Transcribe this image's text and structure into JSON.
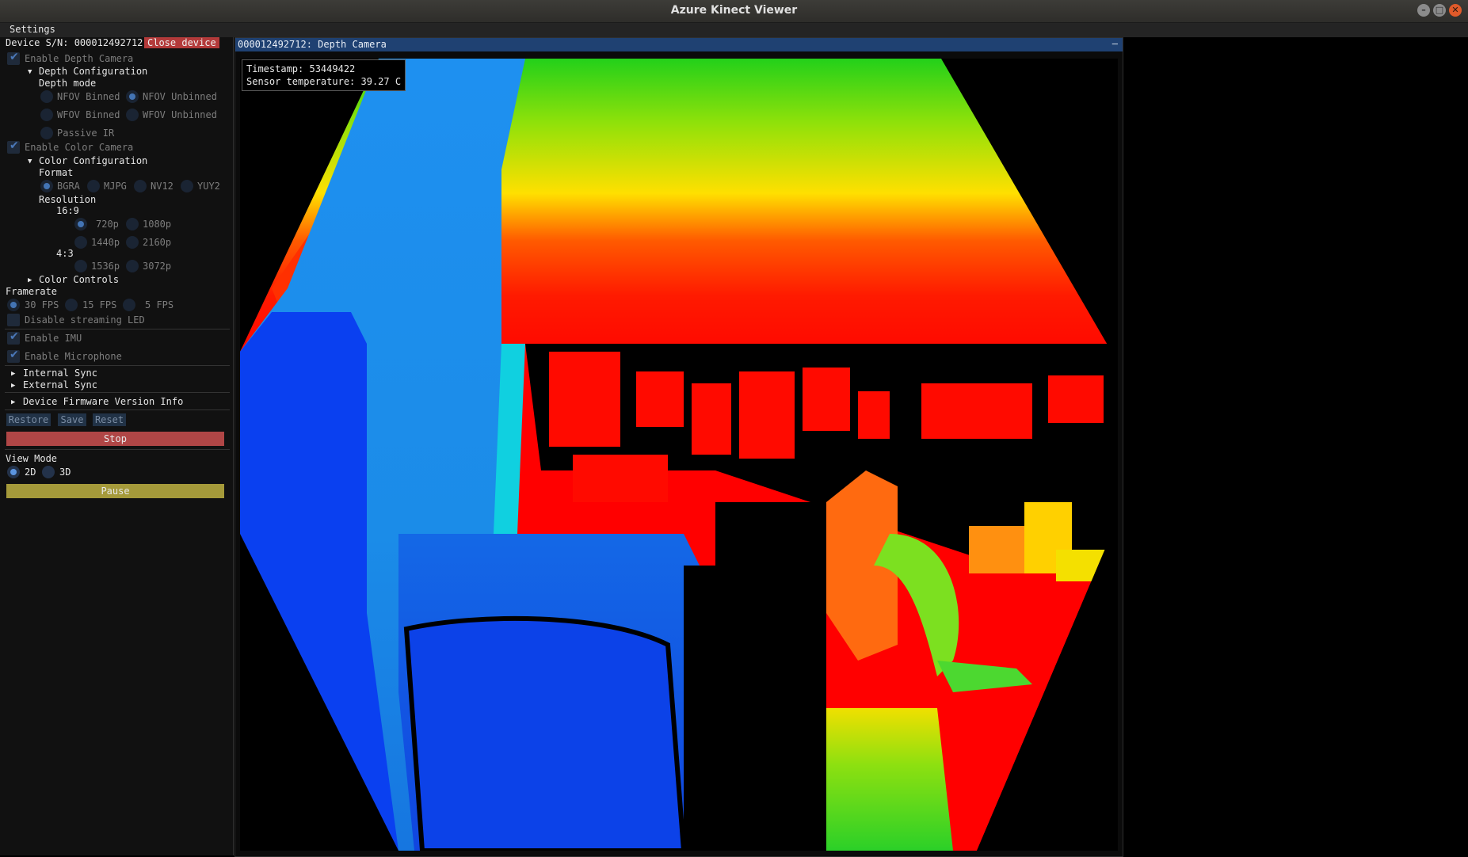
{
  "window": {
    "title": "Azure Kinect Viewer",
    "buttons": [
      "–",
      "□",
      "✕"
    ]
  },
  "menubar": {
    "settings": "Settings"
  },
  "sidebar": {
    "device_sn": "Device S/N: 000012492712",
    "close_device": "Close device",
    "enable_depth_camera": "Enable Depth Camera",
    "depth_configuration": "Depth Configuration",
    "depth_mode": "Depth mode",
    "depth_modes": [
      "NFOV Binned",
      "NFOV Unbinned",
      "WFOV Binned",
      "WFOV Unbinned",
      "Passive IR"
    ],
    "depth_mode_selected": "NFOV Unbinned",
    "enable_color_camera": "Enable Color Camera",
    "color_configuration": "Color Configuration",
    "format": "Format",
    "formats": [
      "BGRA",
      "MJPG",
      "NV12",
      "YUY2"
    ],
    "format_selected": "BGRA",
    "resolution": "Resolution",
    "aspect_16_9": "16:9",
    "res_16_9": [
      "720p",
      "1080p",
      "1440p",
      "2160p"
    ],
    "aspect_4_3": "4:3",
    "res_4_3": [
      "1536p",
      "3072p"
    ],
    "resolution_selected": "720p",
    "color_controls": "Color Controls",
    "framerate": "Framerate",
    "framerates": [
      "30 FPS",
      "15 FPS",
      "5 FPS"
    ],
    "framerate_selected": "30 FPS",
    "disable_streaming_led": "Disable streaming LED",
    "enable_imu": "Enable IMU",
    "enable_microphone": "Enable Microphone",
    "internal_sync": "Internal Sync",
    "external_sync": "External Sync",
    "firmware_info": "Device Firmware Version Info",
    "restore": "Restore",
    "save": "Save",
    "reset": "Reset",
    "stop": "Stop",
    "view_mode": "View Mode",
    "view_modes": [
      "2D",
      "3D"
    ],
    "view_mode_selected": "2D",
    "pause": "Pause"
  },
  "viewer": {
    "header": "000012492712: Depth Camera",
    "minimize": "–",
    "timestamp": "Timestamp: 53449422",
    "sensor_temperature": "Sensor temperature: 39.27 C"
  },
  "colors": {
    "accent_blue": "#4374b4",
    "header_blue": "#1f4172",
    "stop_red": "#b04646",
    "pause_olive": "#a59a3a",
    "close_red": "#b33a3a"
  }
}
